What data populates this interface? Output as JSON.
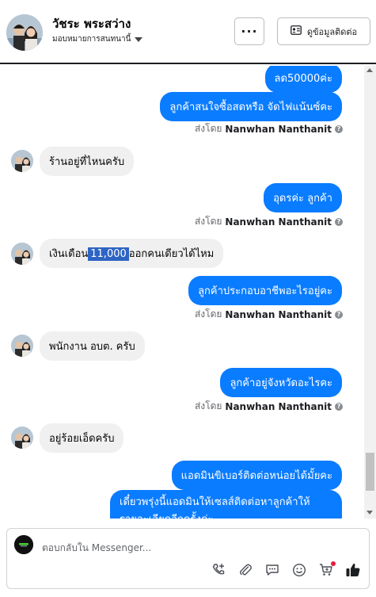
{
  "header": {
    "name": "วัชระ พระสว่าง",
    "assign_label": "มอบหมายการสนทนานี้",
    "more_label": "···",
    "contact_label": "ดูข้อมูลติดต่อ"
  },
  "messages": {
    "out_0": "ลด50000ค่ะ",
    "out_1": "ลูกค้าสนใจซื้อสดหรือ จัดไฟแน้นซ์คะ",
    "in_0": "ร้านอยู่ที่ไหนครับ",
    "out_2": "อุดรค่ะ ลูกค้า",
    "in_1_before": "เงินเดือน",
    "in_1_highlight": "11,000",
    "in_1_after": "ออกคนเดียวได้ไหม",
    "out_3": "ลูกค้าประกอบอาชีพอะไรอยู่คะ",
    "in_2": "พนักงาน อบต. ครับ",
    "out_4": "ลูกค้าอยู่จังหวัดอะไรคะ",
    "in_3": "อยู่ร้อยเอ็ดครับ",
    "out_5": "แอดมินขิเบอร์ติดต่อหน่อยได้มั้ยคะ",
    "out_6_line1": "เดี๋ยวพรุ่งนี้แอดมินให้เซลส์ติดต่อหาลูกค้าให้",
    "out_6_line2": "รายละเอียดอีกครั้งค่ะ"
  },
  "sent_by": {
    "prefix": "ส่งโดย",
    "agent": "Nanwhan Nanthanit"
  },
  "composer": {
    "placeholder": "ตอบกลับใน Messenger..."
  },
  "colors": {
    "outgoing_bubble": "#0a7cff",
    "incoming_bubble": "#f0f0f0",
    "highlight": "#2e64c4"
  },
  "icons": [
    "more-icon",
    "contact-card-icon",
    "caret-down-icon",
    "info-icon",
    "add-call-icon",
    "attach-icon",
    "saved-reply-icon",
    "emoji-icon",
    "cart-icon",
    "like-icon"
  ]
}
